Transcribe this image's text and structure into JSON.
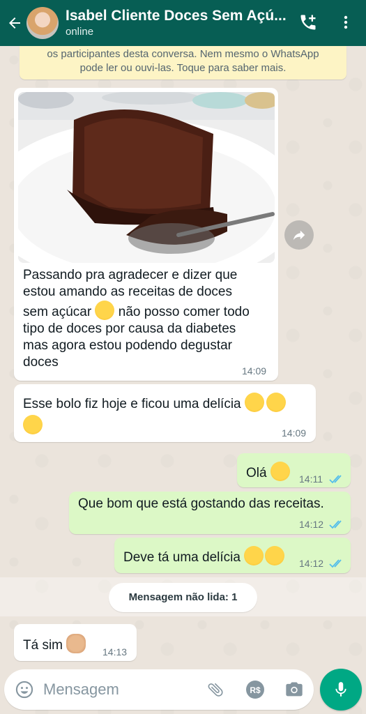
{
  "header": {
    "contact_name": "Isabel Cliente Doces Sem Açú...",
    "status": "online"
  },
  "notice": {
    "line1": "os participantes desta conversa. Nem mesmo o WhatsApp",
    "line2": "pode ler ou ouvi-las. Toque para saber mais."
  },
  "messages": [
    {
      "id": "m1",
      "direction": "incoming",
      "has_image": true,
      "lines": [
        "Passando pra agradecer e dizer que",
        "estou amando as receitas de doces",
        "sem açúcar",
        "não posso comer todo",
        "tipo de doces por causa da diabetes",
        "mas agora estou podendo degustar",
        "doces"
      ],
      "time": "14:09"
    },
    {
      "id": "m2",
      "direction": "incoming",
      "text": "Esse bolo fiz hoje e ficou uma delícia",
      "time": "14:09"
    },
    {
      "id": "m3",
      "direction": "outgoing",
      "text": "Olá",
      "time": "14:11"
    },
    {
      "id": "m4",
      "direction": "outgoing",
      "text": "Que bom que está gostando das receitas.",
      "time": "14:12"
    },
    {
      "id": "m5",
      "direction": "outgoing",
      "text": "Deve tá uma delícia",
      "time": "14:12"
    },
    {
      "id": "m6",
      "direction": "incoming",
      "text": "Tá sim",
      "time": "14:13"
    }
  ],
  "unread_label": "Mensagem não lida: 1",
  "composer": {
    "placeholder": "Mensagem",
    "value": ""
  },
  "icons": {
    "back": "arrow-left-icon",
    "call": "add-call-icon",
    "menu": "more-vert-icon",
    "forward": "forward-icon",
    "emoji": "emoji-icon",
    "attach": "paperclip-icon",
    "payment": "rs-currency-icon",
    "camera": "camera-icon",
    "mic": "mic-icon"
  },
  "colors": {
    "header": "#075e54",
    "outgoing_bubble": "#dcf8c6",
    "incoming_bubble": "#ffffff",
    "notice_bg": "#fdf4c5",
    "read_ticks": "#53bdeb",
    "mic_button": "#00a884"
  }
}
